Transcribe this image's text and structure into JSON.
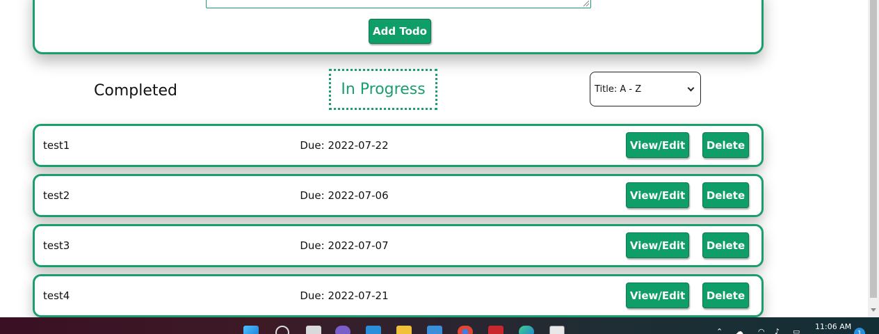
{
  "form": {
    "add_button_label": "Add Todo"
  },
  "filters": {
    "completed_label": "Completed",
    "in_progress_label": "In Progress",
    "sort_selected": "Title: A - Z"
  },
  "todos": [
    {
      "title": "test1",
      "due": "Due: 2022-07-22",
      "view_label": "View/Edit",
      "delete_label": "Delete"
    },
    {
      "title": "test2",
      "due": "Due: 2022-07-06",
      "view_label": "View/Edit",
      "delete_label": "Delete"
    },
    {
      "title": "test3",
      "due": "Due: 2022-07-07",
      "view_label": "View/Edit",
      "delete_label": "Delete"
    },
    {
      "title": "test4",
      "due": "Due: 2022-07-21",
      "view_label": "View/Edit",
      "delete_label": "Delete"
    }
  ],
  "taskbar": {
    "clock": "11:06 AM",
    "notification_count": "1",
    "icons": [
      "windows-start-icon",
      "search-icon",
      "task-view-icon",
      "teams-chat-icon",
      "vscode-icon",
      "file-explorer-icon",
      "store-icon",
      "chrome-icon",
      "filezilla-icon",
      "edge-icon",
      "app-icon"
    ]
  },
  "colors": {
    "accent": "#1a9e6c",
    "button": "#0f9e68"
  }
}
